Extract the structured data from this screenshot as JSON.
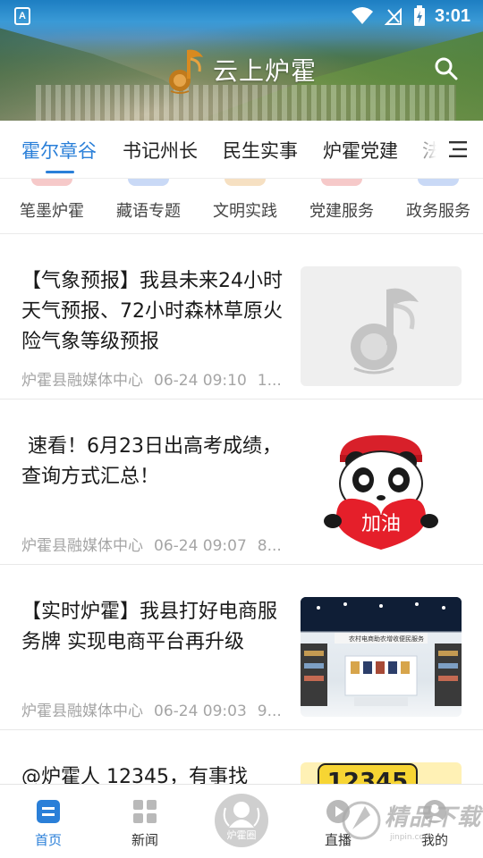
{
  "status_bar": {
    "time": "3:01",
    "notification_badge": "A"
  },
  "header": {
    "title": "云上炉霍",
    "logo_icon": "music-note-logo-icon",
    "search_icon": "search-icon"
  },
  "tabs": {
    "items": [
      {
        "label": "霍尔章谷",
        "active": true
      },
      {
        "label": "书记州长",
        "active": false
      },
      {
        "label": "民生实事",
        "active": false
      },
      {
        "label": "炉霍党建",
        "active": false
      },
      {
        "label": "法",
        "active": false
      }
    ],
    "menu_icon": "menu-icon"
  },
  "subcategories": [
    {
      "label": "笔墨炉霍",
      "color": "#f6c9c9"
    },
    {
      "label": "藏语专题",
      "color": "#c9d9f6"
    },
    {
      "label": "文明实践",
      "color": "#f6e0c2"
    },
    {
      "label": "党建服务",
      "color": "#f6c9c9"
    },
    {
      "label": "政务服务",
      "color": "#c9d9f6"
    }
  ],
  "articles": [
    {
      "title": "【气象预报】我县未来24小时天气预报、72小时森林草原火险气象等级预报",
      "source": "炉霍县融媒体中心",
      "time": "06-24 09:10",
      "extra": "1...",
      "thumb": "placeholder-logo"
    },
    {
      "title": " 速看！6月23日出高考成绩，查询方式汇总！",
      "source": "炉霍县融媒体中心",
      "time": "06-24 09:07",
      "extra": "8...",
      "thumb": "panda",
      "thumb_text": "加油"
    },
    {
      "title": "【实时炉霍】我县打好电商服务牌 实现电商平台再升级",
      "source": "炉霍县融媒体中心",
      "time": "06-24 09:03",
      "extra": "9...",
      "thumb": "store",
      "thumb_signs": [
        "农村电商",
        "助农增收",
        "便民服务"
      ]
    },
    {
      "title": "@炉霍人 12345，有事找",
      "source": "",
      "time": "",
      "extra": "",
      "thumb": "12345",
      "thumb_text": "12345"
    }
  ],
  "bottom_nav": {
    "items": [
      {
        "label": "首页",
        "icon": "home-icon",
        "active": true
      },
      {
        "label": "新闻",
        "icon": "grid-icon",
        "active": false
      },
      {
        "label": "炉霍圈",
        "icon": "community-icon",
        "active": false
      },
      {
        "label": "直播",
        "icon": "play-icon",
        "active": false
      },
      {
        "label": "我的",
        "icon": "profile-icon",
        "active": false
      }
    ]
  },
  "watermark": {
    "text": "精品下载",
    "url": "jinpin.com"
  },
  "colors": {
    "accent": "#2a7fd8",
    "meta_text": "#a5a5a5",
    "divider": "#e8e8e8"
  }
}
